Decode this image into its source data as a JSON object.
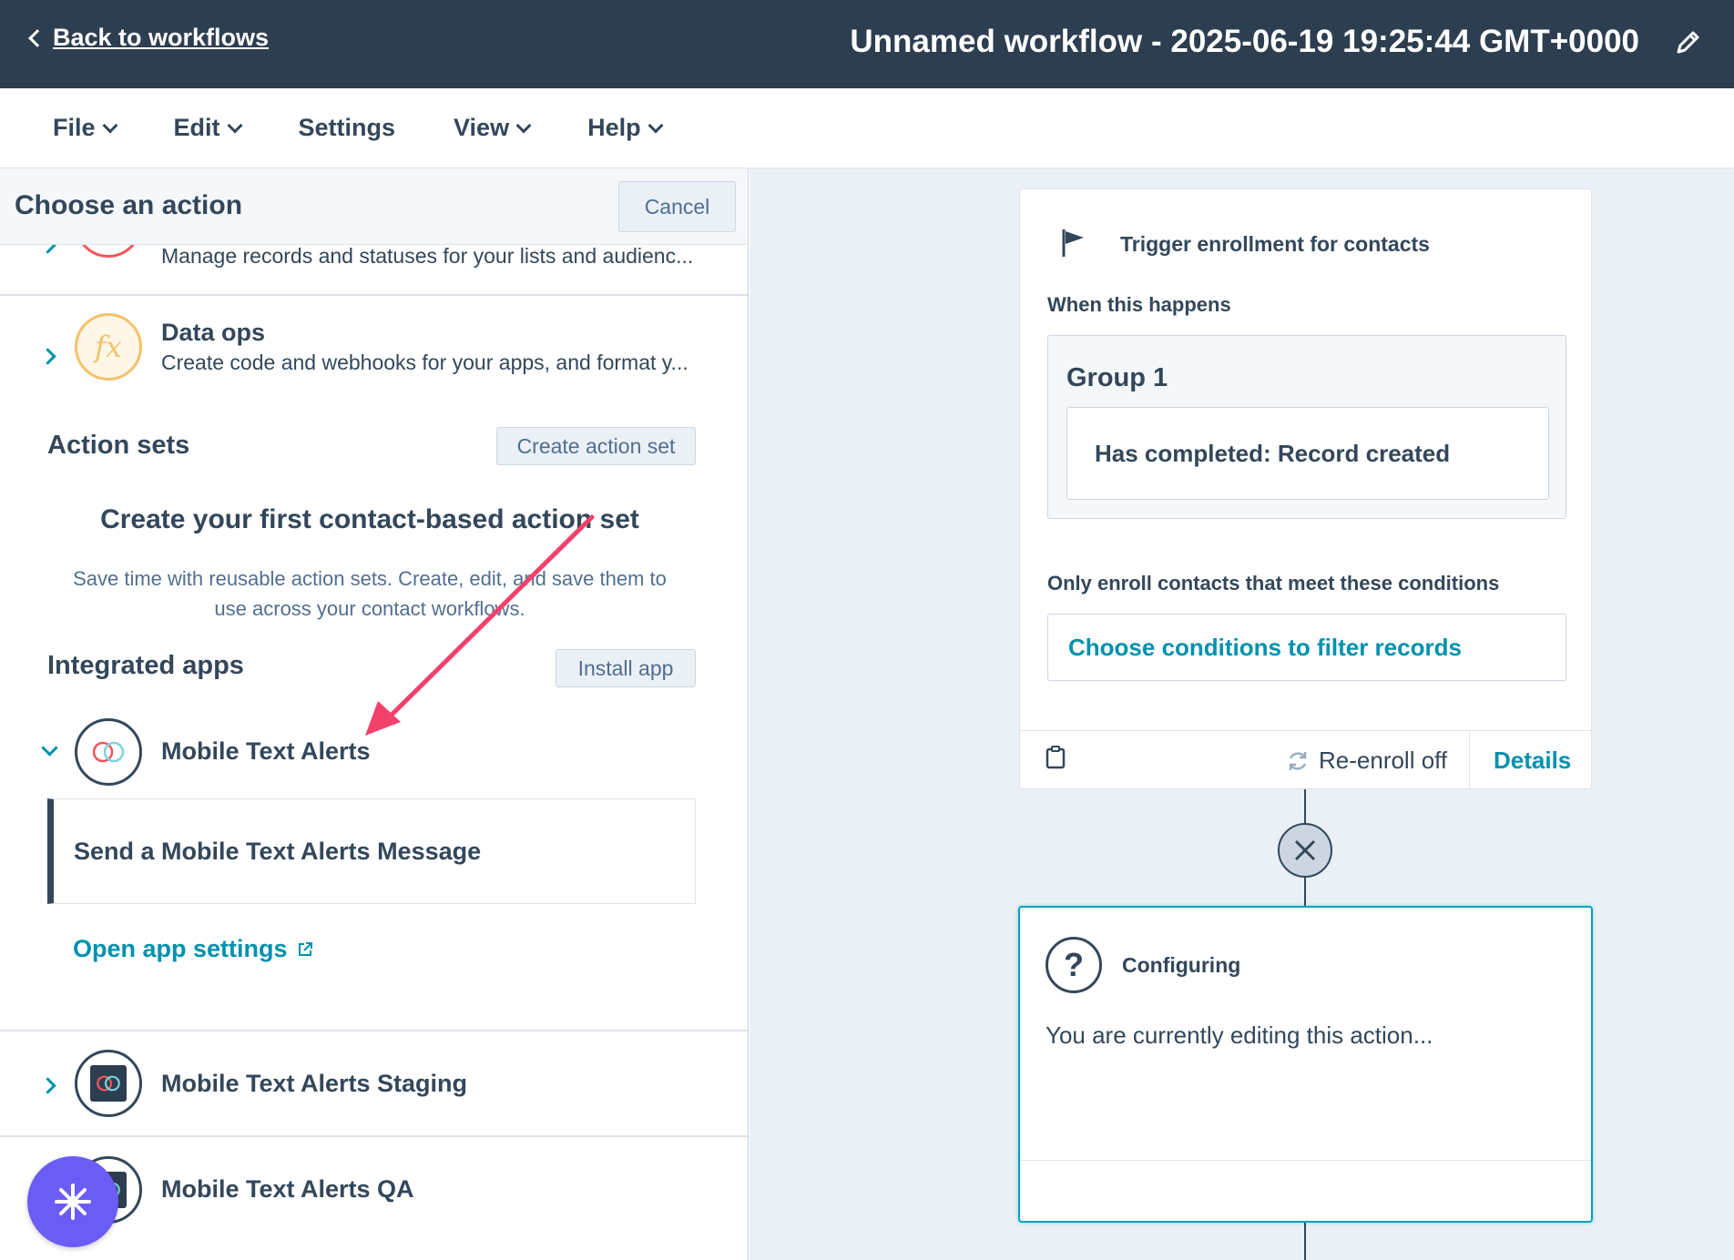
{
  "topbar": {
    "back_label": "Back to workflows",
    "workflow_title": "Unnamed workflow - 2025-06-19 19:25:44 GMT+0000",
    "edit_icon": "pencil-icon"
  },
  "menubar": {
    "items": [
      {
        "label": "File",
        "has_dropdown": true
      },
      {
        "label": "Edit",
        "has_dropdown": true
      },
      {
        "label": "Settings",
        "has_dropdown": false
      },
      {
        "label": "View",
        "has_dropdown": true
      },
      {
        "label": "Help",
        "has_dropdown": true
      }
    ]
  },
  "panel": {
    "title": "Choose an action",
    "cancel_label": "Cancel",
    "partial_row": {
      "desc": "Manage records and statuses for your lists and audienc..."
    },
    "data_ops": {
      "title": "Data ops",
      "desc": "Create code and webhooks for your apps, and format y...",
      "icon": "fx-icon"
    },
    "action_sets": {
      "title": "Action sets",
      "button": "Create action set",
      "empty_title": "Create your first contact-based action set",
      "empty_desc": "Save time with reusable action sets. Create, edit, and save them to use across your contact workflows."
    },
    "integrated_apps": {
      "title": "Integrated apps",
      "button": "Install app",
      "apps": [
        {
          "name": "Mobile Text Alerts",
          "expanded": true
        },
        {
          "name": "Mobile Text Alerts Staging",
          "expanded": false
        },
        {
          "name": "Mobile Text Alerts QA",
          "expanded": false
        }
      ],
      "action": "Send a Mobile Text Alerts Message",
      "settings_link": "Open app settings"
    }
  },
  "canvas": {
    "trigger": {
      "title": "Trigger enrollment for contacts",
      "when_label": "When this happens",
      "group_title": "Group 1",
      "criterion": "Has completed: Record created",
      "conditions_label": "Only enroll contacts that meet these conditions",
      "filter_link": "Choose conditions to filter records",
      "reenroll": "Re-enroll off",
      "details": "Details"
    },
    "config": {
      "title": "Configuring",
      "desc": "You are currently editing this action..."
    }
  },
  "colors": {
    "header_bg": "#2d3e50",
    "accent": "#0091ae",
    "annotation_arrow": "#f2416b",
    "fab": "#6a5cf5"
  }
}
